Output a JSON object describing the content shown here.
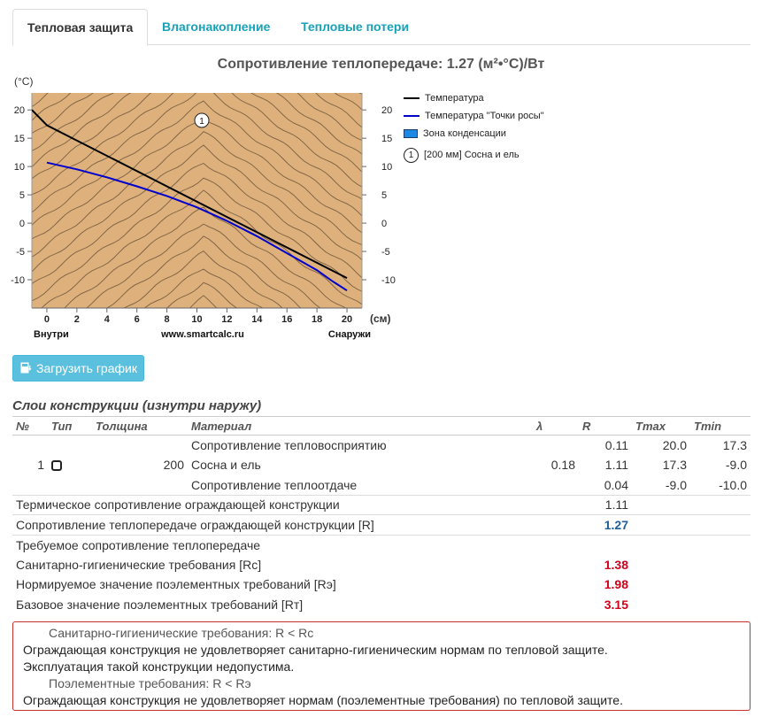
{
  "tabs": [
    {
      "label": "Тепловая защита",
      "active": true
    },
    {
      "label": "Влагонакопление",
      "active": false
    },
    {
      "label": "Тепловые потери",
      "active": false
    }
  ],
  "chart_title": "Сопротивление теплопередаче: 1.27 (м²•°С)/Вт",
  "chart_data": {
    "type": "line",
    "y_unit": "(°С)",
    "x_unit": "(см)",
    "xlim": [
      -1,
      21
    ],
    "ylim": [
      -15,
      23
    ],
    "x_ticks": [
      "0",
      "2",
      "4",
      "6",
      "8",
      "10",
      "12",
      "14",
      "16",
      "18",
      "20"
    ],
    "y_ticks": [
      "20",
      "15",
      "10",
      "5",
      "0",
      "-5",
      "-10"
    ],
    "x_left_label": "Внутри",
    "x_center_label": "www.smartcalc.ru",
    "x_right_label": "Снаружи",
    "series": [
      {
        "name": "Температура",
        "color": "#000000",
        "x": [
          -1,
          0,
          20
        ],
        "y": [
          20,
          17.3,
          -9.7
        ]
      },
      {
        "name": "Температура \"Точки росы\"",
        "color": "#0000cc",
        "x": [
          0,
          2,
          4,
          6,
          8,
          10,
          12,
          14,
          16,
          18,
          19,
          20
        ],
        "y": [
          10.7,
          9.5,
          8.1,
          6.5,
          4.8,
          2.8,
          0.4,
          -2.3,
          -5.3,
          -8.3,
          -10.2,
          -11.9
        ]
      }
    ],
    "legend": [
      "Температура",
      "Температура \"Точки росы\"",
      "Зона конденсации",
      "[200 мм] Сосна и ель"
    ],
    "layer_marker": "1",
    "fill_color": "#ddb07c"
  },
  "download_button": "Загрузить график",
  "section_title": "Слои конструкции (изнутри наружу)",
  "table": {
    "headers": [
      "№",
      "Тип",
      "Толщина",
      "Материал",
      "λ",
      "R",
      "Tmax",
      "Tmin"
    ],
    "rows": [
      {
        "num": "",
        "thickness": "",
        "material": "Сопротивление тепловосприятию",
        "lambda": "",
        "r": "0.11",
        "tmax": "20.0",
        "tmin": "17.3"
      },
      {
        "num": "1",
        "thickness": "200",
        "material": "Сосна и ель",
        "lambda": "0.18",
        "r": "1.11",
        "tmax": "17.3",
        "tmin": "-9.0"
      },
      {
        "num": "",
        "thickness": "",
        "material": "Сопротивление теплоотдаче",
        "lambda": "",
        "r": "0.04",
        "tmax": "-9.0",
        "tmin": "-10.0"
      }
    ],
    "summary": [
      {
        "label": "Термическое сопротивление ограждающей конструкции",
        "value": "1.11",
        "style": "plain"
      },
      {
        "label": "Сопротивление теплопередаче ограждающей конструкции [R]",
        "value": "1.27",
        "style": "blue"
      },
      {
        "label": "Требуемое сопротивление теплопередаче",
        "value": "",
        "style": "plain"
      },
      {
        "label": "Санитарно-гигиенические требования [Rc]",
        "value": "1.38",
        "style": "red"
      },
      {
        "label": "Нормируемое значение поэлементных требований [Rэ]",
        "value": "1.98",
        "style": "red"
      },
      {
        "label": "Базовое значение поэлементных требований [Rт]",
        "value": "3.15",
        "style": "red"
      }
    ]
  },
  "alert": {
    "line1": "Санитарно-гигиенические требования: R < Rc",
    "line2": "Ограждающая конструкция не удовлетворяет санитарно-гигиеническим нормам по тепловой защите.",
    "line3": "Эксплуатация такой конструкции недопустима.",
    "line4": "Поэлементные требования: R < Rэ",
    "line5": "Ограждающая конструкция не удовлетворяет нормам (поэлементные требования) по тепловой защите."
  }
}
